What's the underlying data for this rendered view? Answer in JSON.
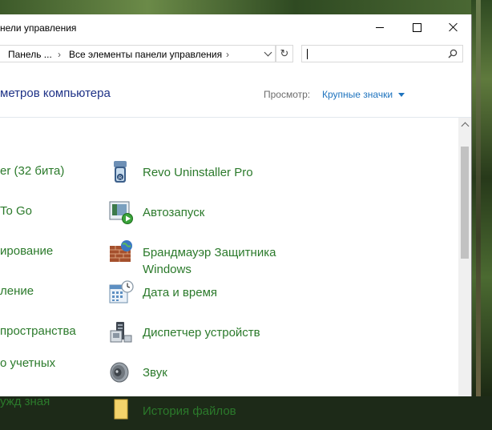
{
  "window": {
    "title": "нели управления",
    "minimize": "minimize",
    "maximize": "maximize",
    "close": "close"
  },
  "address": {
    "crumbs": [
      "Панель ...",
      "Все элементы панели управления"
    ],
    "separator": "›",
    "refresh_glyph": "↻"
  },
  "search": {
    "placeholder": "",
    "value": ""
  },
  "header": {
    "heading": "метров компьютера",
    "view_label": "Просмотр:",
    "view_value": "Крупные значки"
  },
  "left_items": [
    "er (32 бита)",
    "To Go",
    "ирование",
    "ление",
    "пространства",
    "о учетных",
    "ужд зная"
  ],
  "right_items": [
    {
      "label": "Revo Uninstaller Pro",
      "icon": "revo-uninstaller-icon"
    },
    {
      "label": "Автозапуск",
      "icon": "autoplay-icon"
    },
    {
      "label": "Брандмауэр Защитника Windows",
      "icon": "firewall-icon"
    },
    {
      "label": "Дата и время",
      "icon": "date-time-icon"
    },
    {
      "label": "Диспетчер устройств",
      "icon": "device-manager-icon"
    },
    {
      "label": "Звук",
      "icon": "sound-icon"
    },
    {
      "label": "История файлов",
      "icon": "file-history-icon"
    }
  ],
  "colors": {
    "link_green": "#2b7a2b",
    "heading_blue": "#1e3287",
    "view_blue": "#1e73be"
  }
}
